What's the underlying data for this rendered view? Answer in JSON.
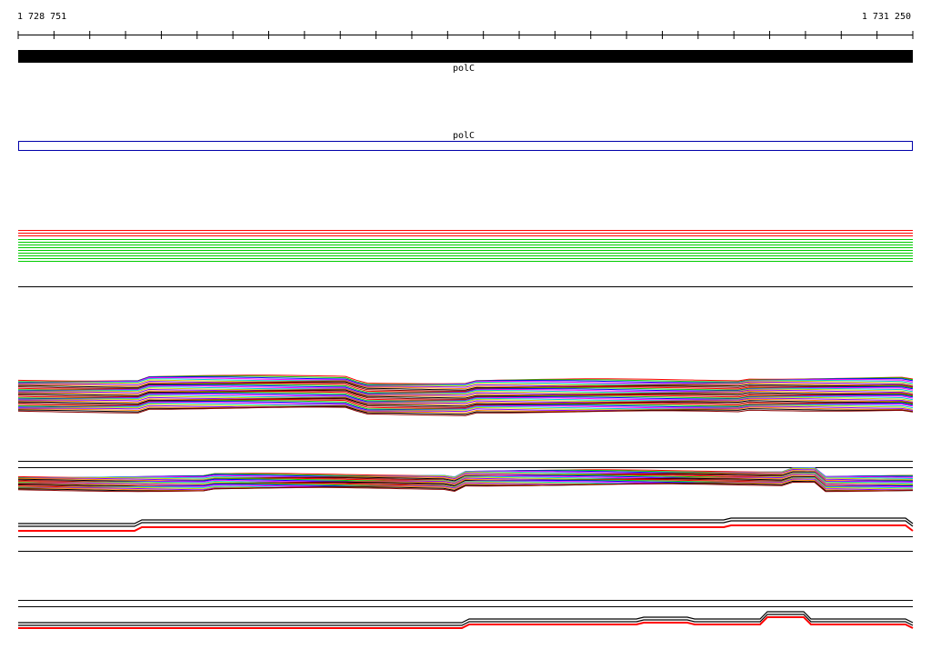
{
  "ruler": {
    "start": "1 728 751",
    "end": "1 731 250"
  },
  "genes": {
    "annotation_label": "polC",
    "outline_label": "polC"
  },
  "colors": {
    "gene_fill": "#000000",
    "gene_outline": "#0000aa",
    "line_palette": [
      "#ff0000",
      "#00cc00",
      "#0000ff",
      "#ff00ff",
      "#00cccc",
      "#cccc00",
      "#8800ff",
      "#ff8800",
      "#000000",
      "#880000"
    ]
  }
}
